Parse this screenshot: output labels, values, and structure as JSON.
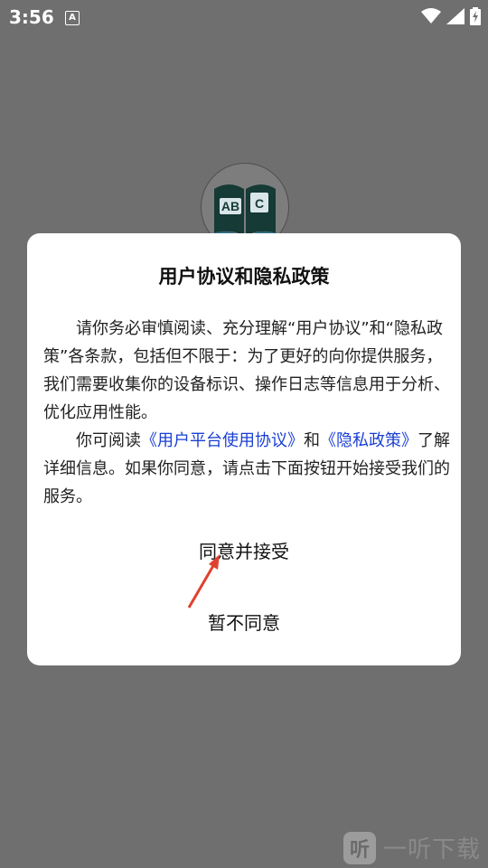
{
  "status_bar": {
    "time": "3:56",
    "notification_glyph": "A"
  },
  "logo": {
    "letters_left": "AB",
    "letters_right": "C"
  },
  "dialog": {
    "title": "用户协议和隐私政策",
    "para1": "请你务必审慎阅读、充分理解“用户协议”和“隐私政策”各条款，包括但不限于：为了更好的向你提供服务，我们需要收集你的设备标识、操作日志等信息用于分析、优化应用性能。",
    "para2_prefix": "你可阅读",
    "link_user_agreement": "《用户平台使用协议》",
    "para2_and": "和",
    "link_privacy": "《隐私政策》",
    "para2_suffix": "了解详细信息。如果你同意，请点击下面按钮开始接受我们的服务。",
    "agree_button": "同意并接受",
    "disagree_button": "暂不同意"
  },
  "watermark": {
    "badge": "听",
    "text": "一听下载"
  }
}
